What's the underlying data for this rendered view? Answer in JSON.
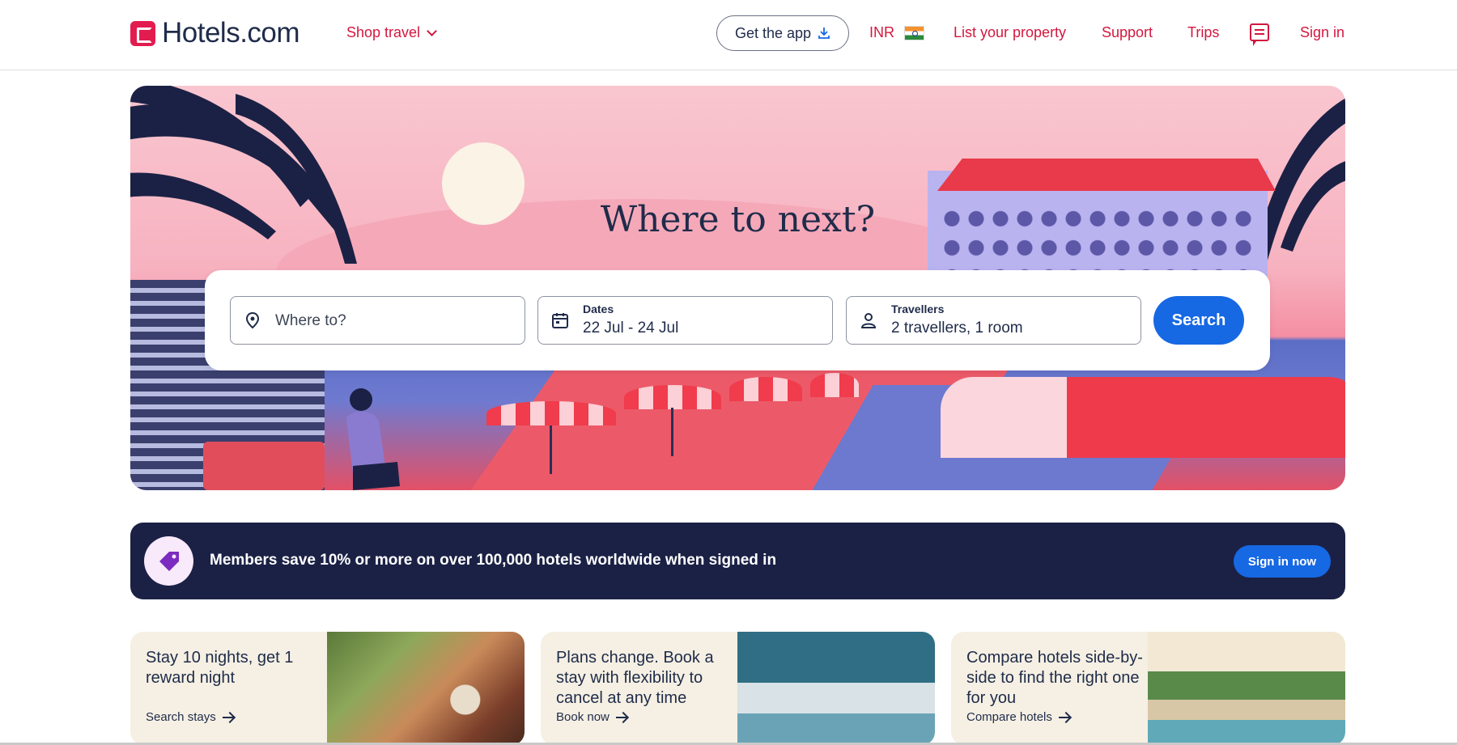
{
  "header": {
    "logo_text": "Hotels.com",
    "shop_travel": "Shop travel",
    "get_app": "Get the app",
    "currency": "INR",
    "list_property": "List your property",
    "support": "Support",
    "trips": "Trips",
    "sign_in": "Sign in"
  },
  "hero": {
    "title": "Where to next?"
  },
  "search": {
    "where_placeholder": "Where to?",
    "dates_label": "Dates",
    "dates_value": "22 Jul - 24 Jul",
    "travellers_label": "Travellers",
    "travellers_value": "2 travellers, 1 room",
    "search_button": "Search"
  },
  "members": {
    "text": "Members save 10% or more on over 100,000 hotels worldwide when signed in",
    "button": "Sign in now"
  },
  "promos": [
    {
      "title": "Stay 10 nights, get 1 reward night",
      "link": "Search stays"
    },
    {
      "title": "Plans change. Book a stay with flexibility to cancel at any time",
      "link": "Book now"
    },
    {
      "title": "Compare hotels side-by-side to find the right one for you",
      "link": "Compare hotels"
    }
  ],
  "colors": {
    "brand_red": "#d3173f",
    "primary_blue": "#1668e3",
    "navy": "#1b2145"
  }
}
